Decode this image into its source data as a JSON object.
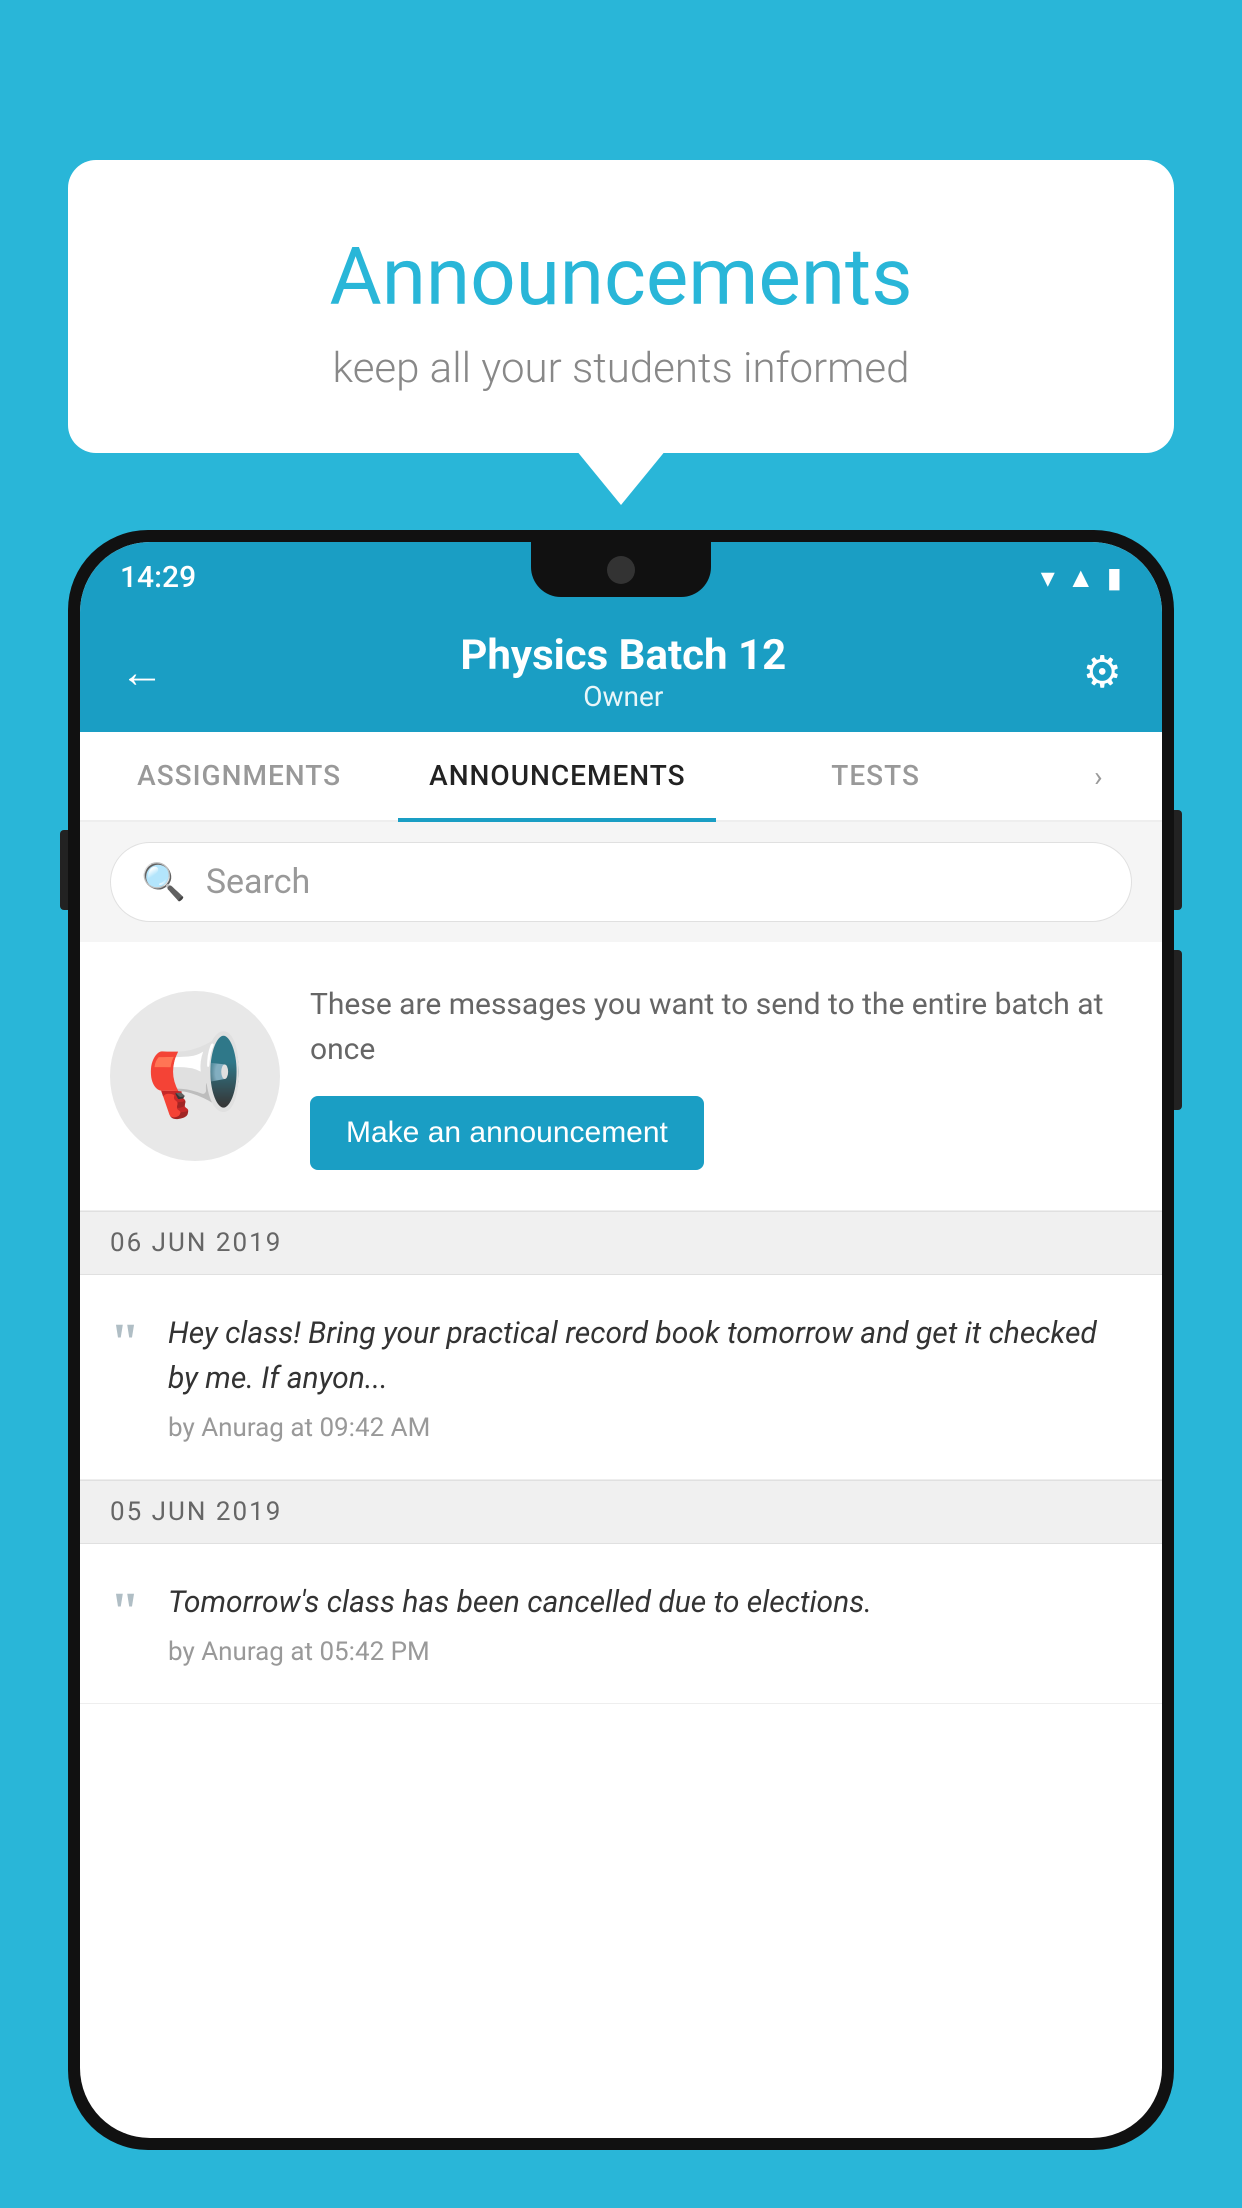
{
  "background_color": "#29b6d8",
  "speech_bubble": {
    "title": "Announcements",
    "subtitle": "keep all your students informed"
  },
  "phone": {
    "status_bar": {
      "time": "14:29",
      "icons": [
        "wifi",
        "signal",
        "battery"
      ]
    },
    "header": {
      "title": "Physics Batch 12",
      "subtitle": "Owner",
      "back_label": "←",
      "gear_label": "⚙"
    },
    "tabs": [
      {
        "label": "ASSIGNMENTS",
        "active": false
      },
      {
        "label": "ANNOUNCEMENTS",
        "active": true
      },
      {
        "label": "TESTS",
        "active": false
      }
    ],
    "tabs_more": "›",
    "search": {
      "placeholder": "Search"
    },
    "promo": {
      "description": "These are messages you want to send to the entire batch at once",
      "button_label": "Make an announcement"
    },
    "announcements": [
      {
        "date": "06  JUN  2019",
        "text": "Hey class! Bring your practical record book tomorrow and get it checked by me. If anyon...",
        "meta": "by Anurag at 09:42 AM"
      },
      {
        "date": "05  JUN  2019",
        "text": "Tomorrow's class has been cancelled due to elections.",
        "meta": "by Anurag at 05:42 PM"
      }
    ]
  }
}
